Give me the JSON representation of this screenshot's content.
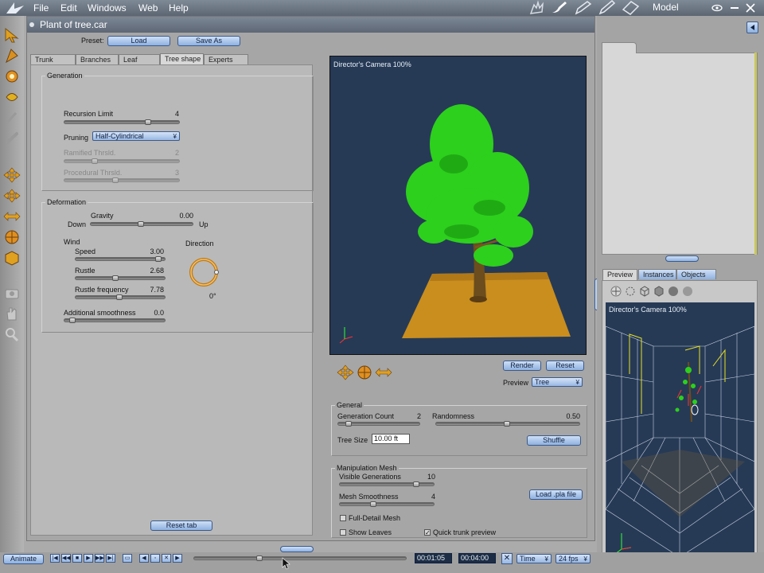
{
  "menubar": {
    "items": [
      "File",
      "Edit",
      "Windows",
      "Web",
      "Help"
    ],
    "mode": "Model"
  },
  "window": {
    "title": "Plant of tree.car"
  },
  "preset": {
    "label": "Preset:",
    "load": "Load",
    "save_as": "Save As"
  },
  "tabs": [
    "Trunk",
    "Branches",
    "Leaf",
    "Tree shape",
    "Experts"
  ],
  "generation": {
    "title": "Generation",
    "recursion_label": "Recursion Limit",
    "recursion_value": "4",
    "recursion_level": 0.75,
    "pruning_label": "Pruning",
    "pruning_value": "Half-Cylindrical",
    "ramified_label": "Ramified Thrsld.",
    "ramified_value": "2",
    "ramified_level": 0.25,
    "procedural_label": "Procedural Thrsld.",
    "procedural_value": "3",
    "procedural_level": 0.45
  },
  "deformation": {
    "title": "Deformation",
    "gravity_label": "Gravity",
    "gravity_value": "0.00",
    "gravity_level": 0.5,
    "down": "Down",
    "up": "Up",
    "wind_label": "Wind",
    "direction_label": "Direction",
    "direction_value": "0°",
    "speed_label": "Speed",
    "speed_value": "3.00",
    "speed_level": 0.98,
    "rustle_label": "Rustle",
    "rustle_value": "2.68",
    "rustle_level": 0.45,
    "rustle_freq_label": "Rustle frequency",
    "rustle_freq_value": "7.78",
    "rustle_freq_level": 0.5,
    "smooth_label": "Additional smoothness",
    "smooth_value": "0.0",
    "smooth_level": 0.05
  },
  "reset_tab": "Reset tab",
  "viewport": {
    "camera": "Director's Camera 100%"
  },
  "render": {
    "render": "Render",
    "reset": "Reset",
    "preview_label": "Preview",
    "preview_value": "Tree"
  },
  "general": {
    "title": "General",
    "gen_count_label": "Generation Count",
    "gen_count_value": "2",
    "gen_count_level": 0.1,
    "randomness_label": "Randomness",
    "randomness_value": "0.50",
    "randomness_level": 0.5,
    "tree_size_label": "Tree Size",
    "tree_size_value": "10.00 ft",
    "shuffle": "Shuffle"
  },
  "mesh": {
    "title": "Manipulation Mesh",
    "visible_label": "Visible Generations",
    "visible_value": "10",
    "visible_level": 0.85,
    "smooth_label": "Mesh Smoothness",
    "smooth_value": "4",
    "smooth_level": 0.35,
    "load_pla": "Load .pla file",
    "full_detail": "Full-Detail Mesh",
    "show_leaves": "Show Leaves",
    "quick_trunk": "Quick trunk preview"
  },
  "side_tabs": [
    "Preview",
    "Instances",
    "Objects"
  ],
  "side_viewport": {
    "camera": "Director's Camera 100%"
  },
  "bottom": {
    "animate": "Animate",
    "time_current": "00:01:05",
    "time_total": "00:04:00",
    "time_select": "Time",
    "fps_select": "24 fps"
  }
}
